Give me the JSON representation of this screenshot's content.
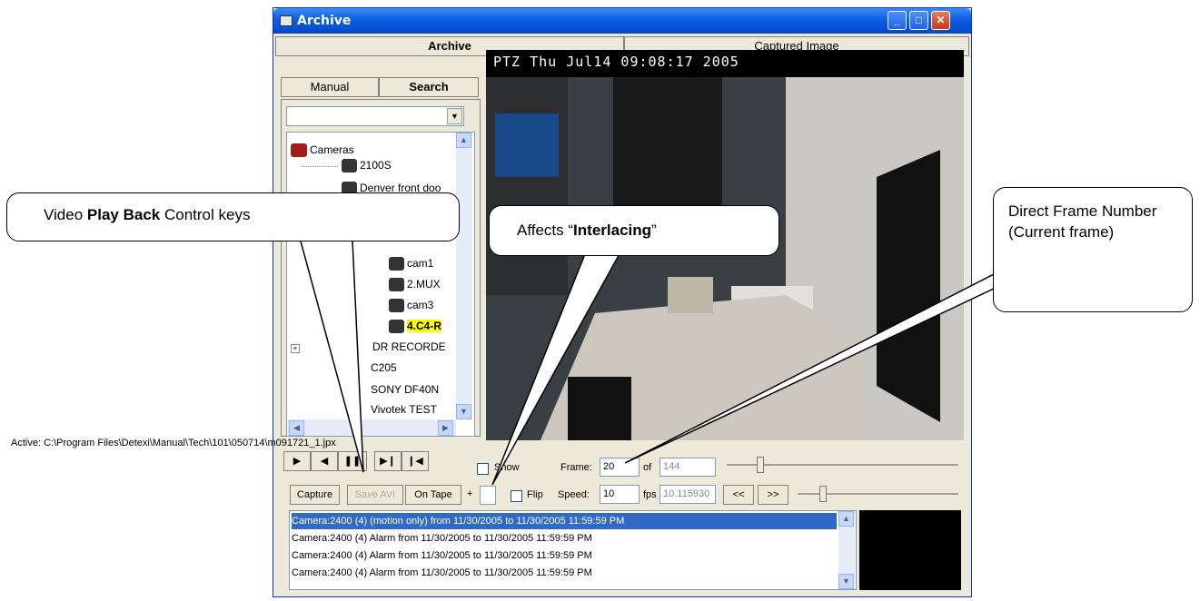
{
  "window": {
    "title": "Archive"
  },
  "tabs": {
    "archive": "Archive",
    "captured": "Captured Image"
  },
  "subtabs": {
    "manual": "Manual",
    "search": "Search"
  },
  "tree": {
    "root": "Cameras",
    "items": [
      "2100S",
      "Denver front doo",
      "cam1",
      "2.MUX",
      "cam3",
      "4.C4-R",
      "DR RECORDE",
      "C205",
      "SONY DF40N",
      "Vivotek TEST"
    ]
  },
  "video": {
    "osd": "PTZ  Thu Jul14  09:08:17  2005"
  },
  "active_path": "Active: C:\\Program Files\\Detexi\\Manual\\Tech\\101\\050714\\m091721_1.jpx",
  "playback": {
    "play": "▶",
    "reverse": "◀",
    "pause": "❚❚",
    "step_forward": "▶❙",
    "step_back": "❙◀"
  },
  "controls": {
    "show_label": "Show",
    "frame_label": "Frame:",
    "frame_value": "20",
    "of_label": "of",
    "frame_total": "144",
    "flip_label": "Flip",
    "speed_label": "Speed:",
    "speed_value": "10",
    "fps_label": "fps",
    "fps_value": "10.115930",
    "capture": "Capture",
    "save_avi": "Save AVI",
    "on_tape": "On Tape",
    "plus": "+",
    "prev": "<<",
    "next": ">>"
  },
  "events": [
    "Camera:2400 (4) (motion only) from 11/30/2005 to 11/30/2005 11:59:59 PM",
    "Camera:2400 (4) Alarm from 11/30/2005 to 11/30/2005 11:59:59 PM",
    "Camera:2400 (4) Alarm from 11/30/2005 to 11/30/2005 11:59:59 PM",
    "Camera:2400 (4) Alarm from 11/30/2005 to 11/30/2005 11:59:59 PM"
  ],
  "callouts": {
    "playback_pre": "Video ",
    "playback_bold": "Play Back",
    "playback_post": " Control keys",
    "interlace_pre": "Affects  “",
    "interlace_bold": "Interlacing",
    "interlace_post": "”",
    "frame": "Direct Frame Number (Current frame)"
  },
  "colors": {
    "titlebar": "#0a5ee0",
    "selection": "#316ac5",
    "highlight": "#ffff00"
  }
}
